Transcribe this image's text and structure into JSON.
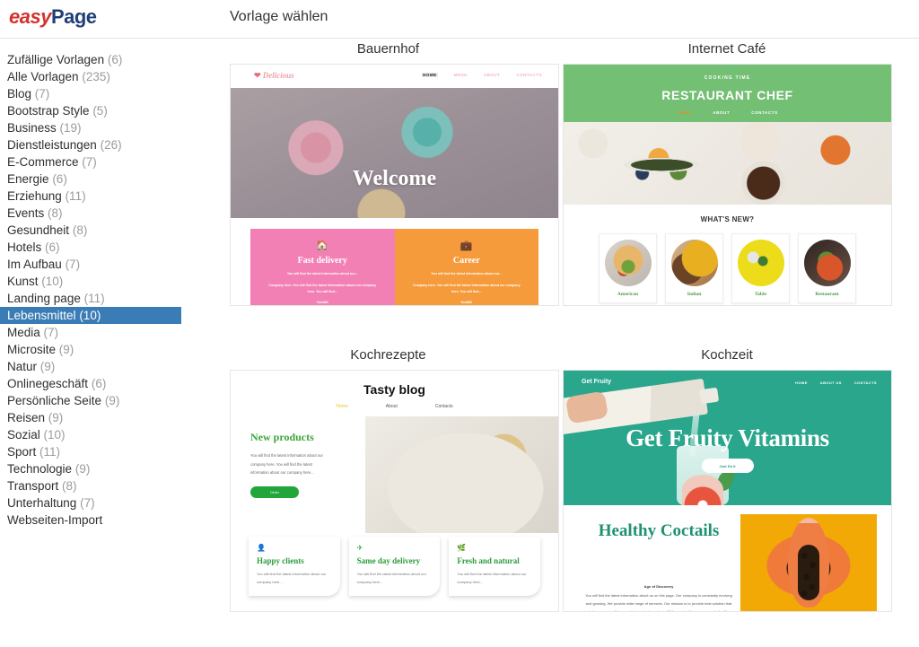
{
  "app": {
    "logo_first": "easy",
    "logo_second": "Page",
    "page_title": "Vorlage wählen"
  },
  "sidebar": {
    "items": [
      {
        "label": "Zufällige Vorlagen",
        "count": "(6)",
        "selected": false
      },
      {
        "label": "Alle Vorlagen",
        "count": "(235)",
        "selected": false
      },
      {
        "label": "Blog",
        "count": "(7)",
        "selected": false
      },
      {
        "label": "Bootstrap Style",
        "count": "(5)",
        "selected": false
      },
      {
        "label": "Business",
        "count": "(19)",
        "selected": false
      },
      {
        "label": "Dienstleistungen",
        "count": "(26)",
        "selected": false
      },
      {
        "label": "E-Commerce",
        "count": "(7)",
        "selected": false
      },
      {
        "label": "Energie",
        "count": "(6)",
        "selected": false
      },
      {
        "label": "Erziehung",
        "count": "(11)",
        "selected": false
      },
      {
        "label": "Events",
        "count": "(8)",
        "selected": false
      },
      {
        "label": "Gesundheit",
        "count": "(8)",
        "selected": false
      },
      {
        "label": "Hotels",
        "count": "(6)",
        "selected": false
      },
      {
        "label": "Im Aufbau",
        "count": "(7)",
        "selected": false
      },
      {
        "label": "Kunst",
        "count": "(10)",
        "selected": false
      },
      {
        "label": "Landing page",
        "count": "(11)",
        "selected": false
      },
      {
        "label": "Lebensmittel",
        "count": "(10)",
        "selected": true
      },
      {
        "label": "Media",
        "count": "(7)",
        "selected": false
      },
      {
        "label": "Microsite",
        "count": "(9)",
        "selected": false
      },
      {
        "label": "Natur",
        "count": "(9)",
        "selected": false
      },
      {
        "label": "Onlinegeschäft",
        "count": "(6)",
        "selected": false
      },
      {
        "label": "Persönliche Seite",
        "count": "(9)",
        "selected": false
      },
      {
        "label": "Reisen",
        "count": "(9)",
        "selected": false
      },
      {
        "label": "Sozial",
        "count": "(10)",
        "selected": false
      },
      {
        "label": "Sport",
        "count": "(11)",
        "selected": false
      },
      {
        "label": "Technologie",
        "count": "(9)",
        "selected": false
      },
      {
        "label": "Transport",
        "count": "(8)",
        "selected": false
      },
      {
        "label": "Unterhaltung",
        "count": "(7)",
        "selected": false
      },
      {
        "label": "Webseiten-Import",
        "count": "",
        "selected": false
      }
    ],
    "selected_color": "#3a7cb5"
  },
  "templates": {
    "bauernhof": {
      "title": "Bauernhof",
      "logo": "Delicious",
      "nav": [
        "HOME",
        "MENU",
        "ABOUT",
        "CONTACTS"
      ],
      "hero_heading": "Welcome",
      "cards": [
        {
          "icon": "home-icon",
          "title": "Fast delivery",
          "lead": "You will find the latest information about our...",
          "body": "Company here. You will find the latest information about our company here. You will find...",
          "link": "YouWill",
          "color": "#f280b4"
        },
        {
          "icon": "briefcase-icon",
          "title": "Career",
          "lead": "You will find the latest information about our...",
          "body": "Company here. You will find the latest information about our company here. You will find...",
          "link": "YouWill",
          "color": "#f59b3c"
        }
      ]
    },
    "internet_cafe": {
      "title": "Internet Café",
      "eyebrow": "COOKING TIME",
      "heading": "RESTAURANT CHEF",
      "nav": [
        "HOME",
        "ABOUT",
        "CONTACTS"
      ],
      "section_heading": "WHAT'S NEW?",
      "cards": [
        {
          "caption": "American"
        },
        {
          "caption": "Indian"
        },
        {
          "caption": "Table"
        },
        {
          "caption": "Restaurant"
        }
      ],
      "header_color": "#73bf73",
      "caption_color": "#4a9a45"
    },
    "kochrezepte": {
      "title": "Kochrezepte",
      "site_title": "Tasty blog",
      "nav": [
        "Home",
        "About",
        "Contacts"
      ],
      "section_heading": "New products",
      "section_body": "You will find the latest information about our company here. You will find the latest information about our company here...",
      "button": "Order",
      "cards": [
        {
          "icon": "person-icon",
          "title": "Happy clients",
          "body": "You will find the latest information about our company here..."
        },
        {
          "icon": "paper-plane-icon",
          "title": "Same day delivery",
          "body": "You will find the latest information about our company here..."
        },
        {
          "icon": "leaf-icon",
          "title": "Fresh and natural",
          "body": "You will find the latest information about our company here..."
        }
      ],
      "accent_color": "#22a53a"
    },
    "kochzeit": {
      "title": "Kochzeit",
      "logo": "Get Fruity",
      "nav": [
        "HOME",
        "ABOUT US",
        "CONTACTS"
      ],
      "hero_heading": "Get Fruity Vitamins",
      "hero_button": "Just Do It",
      "section_heading": "Healthy Coctails",
      "section_eyebrow": "Age of Discovery",
      "section_body": "You will find the latest information about us on this page. Our company is constantly evolving and growing. We provide wide range of services. Our mission is to provide best solution that helps everyone. If you want to contact us, please fill the contact form on our website. We wish you a...",
      "hero_color": "#29a68b",
      "heading_color": "#1f9170"
    }
  }
}
